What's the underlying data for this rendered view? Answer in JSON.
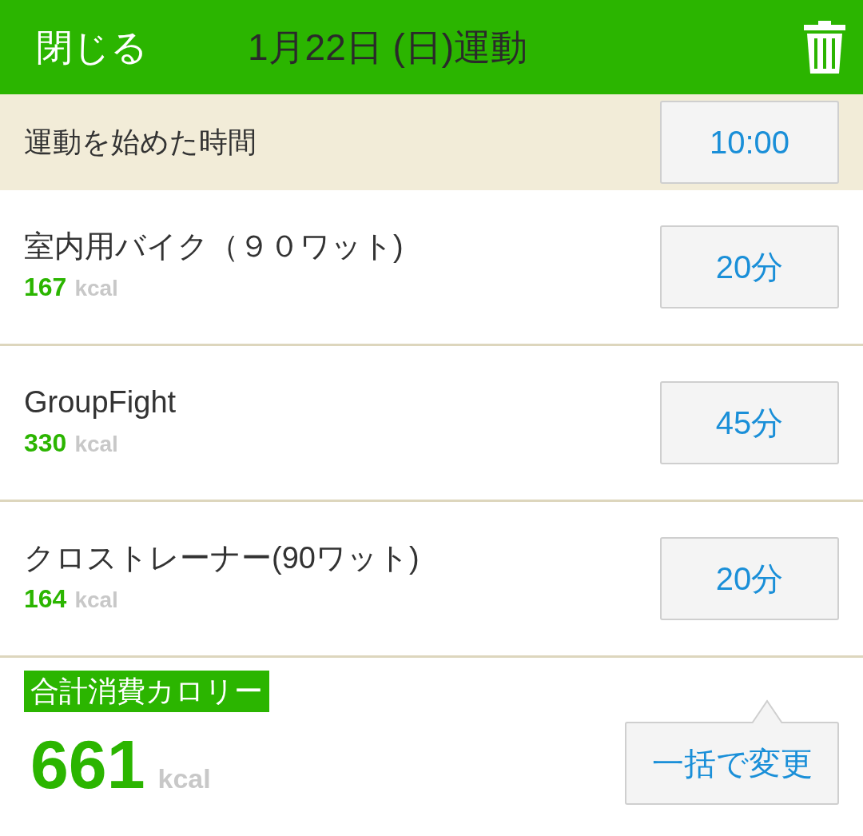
{
  "header": {
    "close": "閉じる",
    "title": "1月22日 (日)運動"
  },
  "start_time": {
    "label": "運動を始めた時間",
    "value": "10:00"
  },
  "exercises": [
    {
      "name": "室内用バイク（９０ワット)",
      "kcal": "167",
      "unit": "kcal",
      "duration": "20分"
    },
    {
      "name": "GroupFight",
      "kcal": "330",
      "unit": "kcal",
      "duration": "45分"
    },
    {
      "name": "クロストレーナー(90ワット)",
      "kcal": "164",
      "unit": "kcal",
      "duration": "20分"
    }
  ],
  "total": {
    "label": "合計消費カロリー",
    "value": "661",
    "unit": "kcal",
    "button": "一括で変更"
  }
}
